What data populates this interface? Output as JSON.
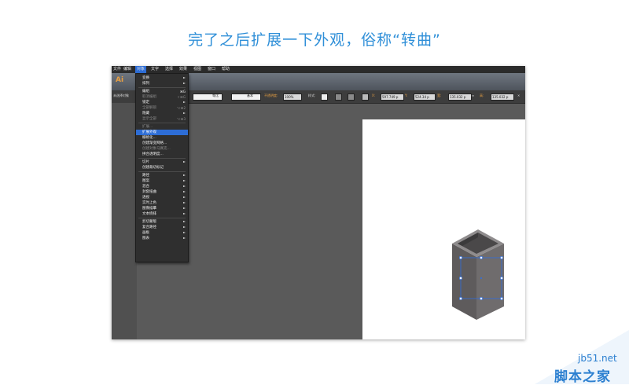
{
  "caption": "完了之后扩展一下外观，俗称“转曲”",
  "menubar": [
    "文件",
    "编辑",
    "对象",
    "文字",
    "选择",
    "效果",
    "视图",
    "窗口",
    "帮助"
  ],
  "menubar_active": 2,
  "app": {
    "logo": "Ai"
  },
  "ctrlbar": {
    "left_label": "未选择对象",
    "stroke1": "等比",
    "stroke2": "基本",
    "opacity_label": "不透明度:",
    "opacity_value": "100%",
    "style_label": "样式:",
    "x_label": "X:",
    "x_value": "597.749 p",
    "y_label": "Y:",
    "y_value": "524.34 p",
    "w_label": "宽:",
    "w_value": "135.032 p",
    "h_label": "高:",
    "h_value": "135.032 p"
  },
  "menu": {
    "items": [
      {
        "label": "变换",
        "shortcut": "",
        "sub": true,
        "dis": false
      },
      {
        "label": "排列",
        "shortcut": "",
        "sub": true,
        "dis": false
      },
      {
        "sep": true
      },
      {
        "label": "编组",
        "shortcut": "⌘G",
        "sub": false,
        "dis": false
      },
      {
        "label": "取消编组",
        "shortcut": "⇧⌘G",
        "sub": false,
        "dis": true
      },
      {
        "label": "锁定",
        "shortcut": "",
        "sub": true,
        "dis": false
      },
      {
        "label": "全部解锁",
        "shortcut": "⌥⌘2",
        "sub": false,
        "dis": true
      },
      {
        "label": "隐藏",
        "shortcut": "",
        "sub": true,
        "dis": false
      },
      {
        "label": "显示全部",
        "shortcut": "⌥⌘3",
        "sub": false,
        "dis": true
      },
      {
        "sep": true
      },
      {
        "label": "扩展...",
        "shortcut": "",
        "sub": false,
        "dis": true
      },
      {
        "label": "扩展外观",
        "shortcut": "",
        "sub": false,
        "dis": false,
        "hl": true
      },
      {
        "label": "栅格化...",
        "shortcut": "",
        "sub": false,
        "dis": false
      },
      {
        "label": "创建渐变网格...",
        "shortcut": "",
        "sub": false,
        "dis": false
      },
      {
        "label": "创建对象马赛克...",
        "shortcut": "",
        "sub": false,
        "dis": true
      },
      {
        "label": "拼合透明度...",
        "shortcut": "",
        "sub": false,
        "dis": false
      },
      {
        "sep": true
      },
      {
        "label": "切片",
        "shortcut": "",
        "sub": true,
        "dis": false
      },
      {
        "label": "创建裁切标记",
        "shortcut": "",
        "sub": false,
        "dis": false
      },
      {
        "sep": true
      },
      {
        "label": "路径",
        "shortcut": "",
        "sub": true,
        "dis": false
      },
      {
        "label": "图案",
        "shortcut": "",
        "sub": true,
        "dis": false
      },
      {
        "label": "混合",
        "shortcut": "",
        "sub": true,
        "dis": false
      },
      {
        "label": "封套扭曲",
        "shortcut": "",
        "sub": true,
        "dis": false
      },
      {
        "label": "透视",
        "shortcut": "",
        "sub": true,
        "dis": false
      },
      {
        "label": "实时上色",
        "shortcut": "",
        "sub": true,
        "dis": false
      },
      {
        "label": "图像描摹",
        "shortcut": "",
        "sub": true,
        "dis": false
      },
      {
        "label": "文本绕排",
        "shortcut": "",
        "sub": true,
        "dis": false
      },
      {
        "sep": true
      },
      {
        "label": "剪切蒙版",
        "shortcut": "",
        "sub": true,
        "dis": false
      },
      {
        "label": "复合路径",
        "shortcut": "",
        "sub": true,
        "dis": false
      },
      {
        "label": "画板",
        "shortcut": "",
        "sub": true,
        "dis": false
      },
      {
        "label": "图表",
        "shortcut": "",
        "sub": true,
        "dis": false
      }
    ]
  },
  "watermark": {
    "url": "jb51.net",
    "name": "脚本之家"
  },
  "colors": {
    "accent": "#2f8fd8",
    "menu_highlight": "#2d6dd6",
    "box_front": "#6e6b6c",
    "box_side": "#4f4d4e",
    "box_top": "#8c898a",
    "selection": "#2f6fe0"
  }
}
